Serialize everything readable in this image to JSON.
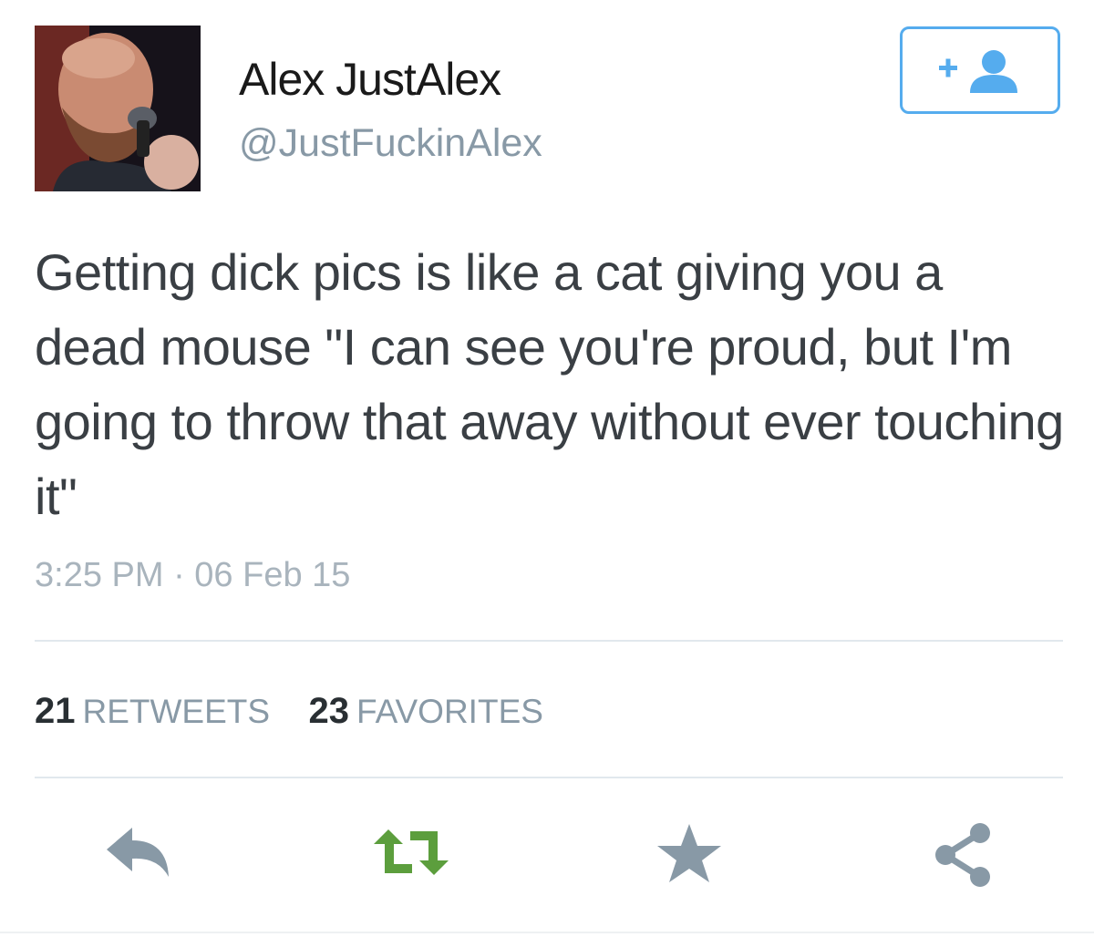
{
  "user": {
    "display_name": "Alex JustAlex",
    "handle": "@JustFuckinAlex"
  },
  "follow_button": {
    "icon": "add-user-icon",
    "color": "#55acee"
  },
  "tweet": {
    "text": "Getting dick pics is like a cat giving you a dead mouse \"I can see you're proud, but I'm going to throw that away without ever touching it\"",
    "timestamp": "3:25 PM · 06 Feb 15"
  },
  "stats": {
    "retweets_count": "21",
    "retweets_label": "RETWEETS",
    "favorites_count": "23",
    "favorites_label": "FAVORITES"
  },
  "actions": [
    {
      "icon": "reply-icon",
      "color": "#8899a6"
    },
    {
      "icon": "retweet-icon",
      "color": "#5c9e3d"
    },
    {
      "icon": "star-icon",
      "color": "#8899a6"
    },
    {
      "icon": "share-icon",
      "color": "#8899a6"
    }
  ]
}
